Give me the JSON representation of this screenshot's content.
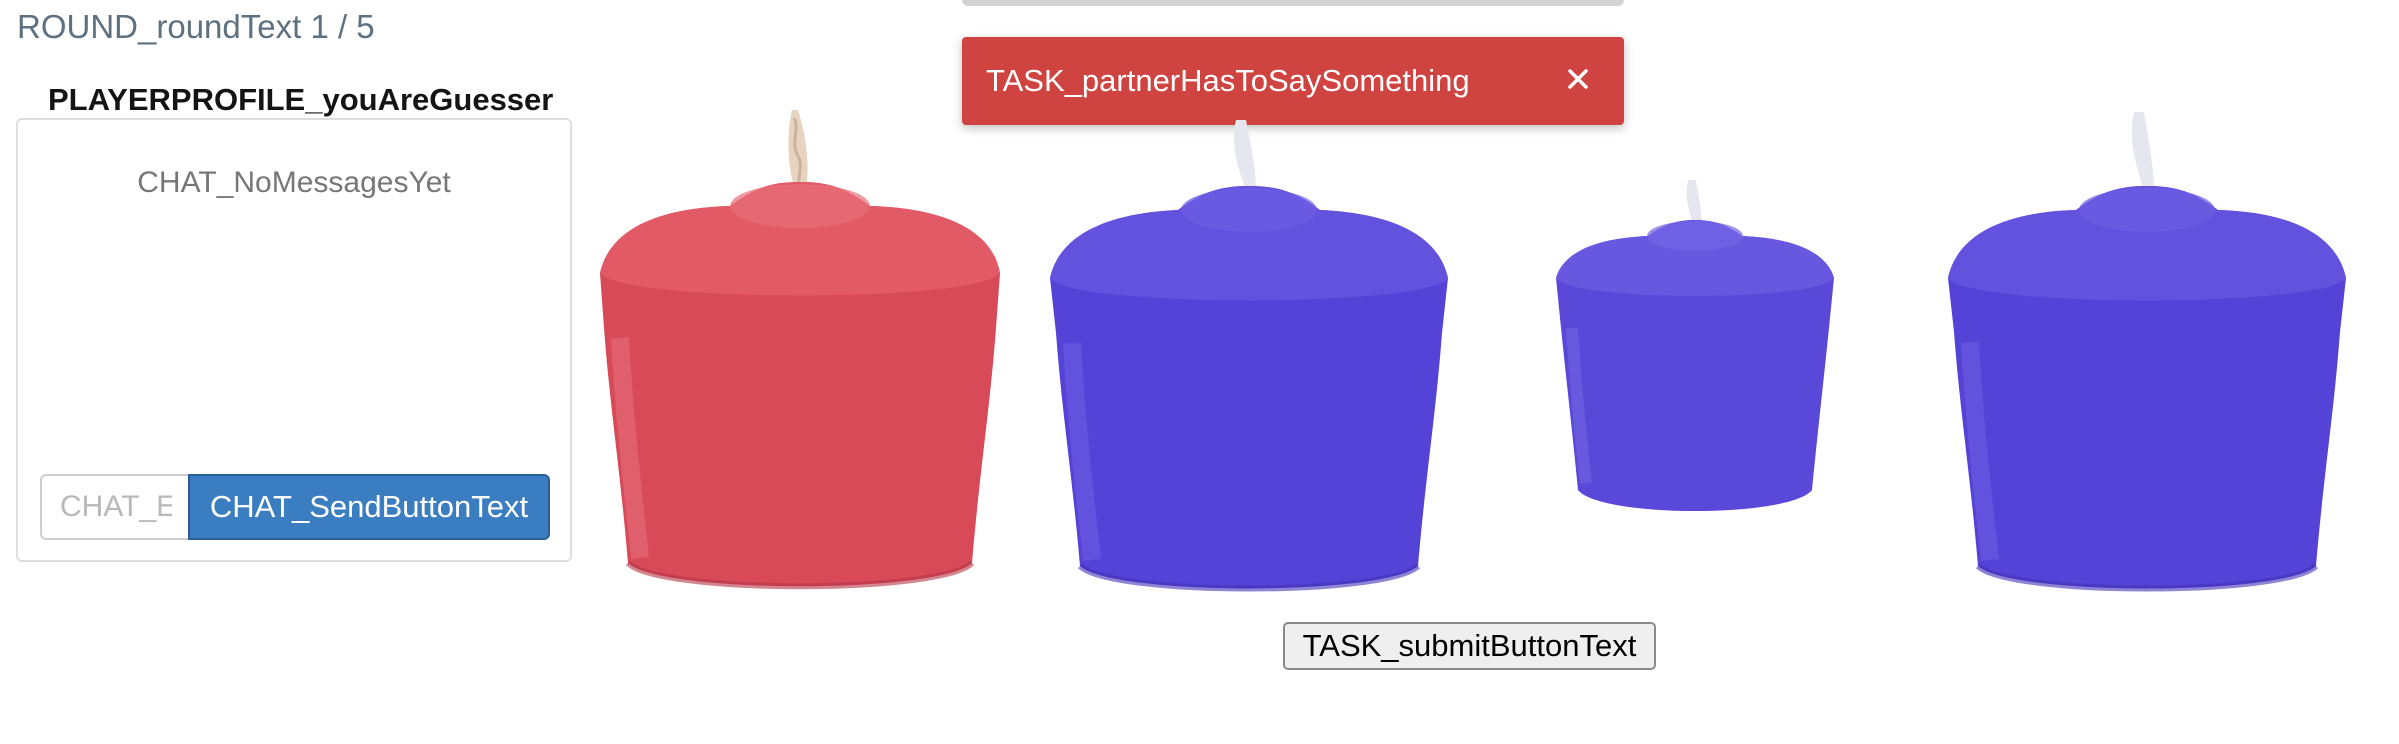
{
  "round": {
    "text": "ROUND_roundText 1 / 5"
  },
  "profile": {
    "title": "PLAYERPROFILE_youAreGuesser"
  },
  "chat": {
    "empty_text": "CHAT_NoMessagesYet",
    "input_placeholder": "CHAT_EnterMessage",
    "input_value": "",
    "send_label": "CHAT_SendButtonText"
  },
  "toast": {
    "message": "TASK_partnerHasToSaySomething",
    "close_icon": "close-icon",
    "color": "#cf4440"
  },
  "candles": [
    {
      "color_name": "red",
      "color": "#d84a58"
    },
    {
      "color_name": "blue",
      "color": "#5542d6"
    },
    {
      "color_name": "blue",
      "color": "#5542d6"
    },
    {
      "color_name": "blue",
      "color": "#5542d6"
    }
  ],
  "task": {
    "submit_label": "TASK_submitButtonText"
  },
  "colors": {
    "accent": "#3a7dc0",
    "text_muted": "#5e7181"
  }
}
